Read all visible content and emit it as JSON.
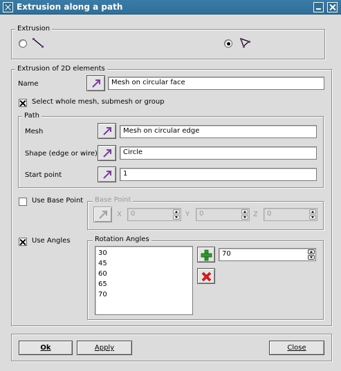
{
  "window": {
    "title": "Extrusion along a path"
  },
  "extrusion": {
    "legend": "Extrusion",
    "selected": "2d"
  },
  "elements2d": {
    "legend": "Extrusion of 2D elements",
    "name_label": "Name",
    "name_value": "Mesh on circular face",
    "select_whole_label": "Select whole mesh, submesh or group",
    "select_whole_checked": true
  },
  "path": {
    "legend": "Path",
    "mesh_label": "Mesh",
    "mesh_value": "Mesh on circular edge",
    "shape_label": "Shape (edge or wire)",
    "shape_value": "Circle",
    "start_label": "Start point",
    "start_value": "1"
  },
  "base_point": {
    "use_label": "Use Base Point",
    "checked": false,
    "legend": "Base Point",
    "x_label": "X",
    "x_value": "0",
    "y_label": "Y",
    "y_value": "0",
    "z_label": "Z",
    "z_value": "0"
  },
  "angles": {
    "use_label": "Use Angles",
    "checked": true,
    "legend": "Rotation Angles",
    "list": [
      "30",
      "45",
      "60",
      "65",
      "70"
    ],
    "input_value": "70"
  },
  "buttons": {
    "ok": "Ok",
    "apply": "Apply",
    "close": "Close"
  },
  "colors": {
    "titlebar": "#2f6f98",
    "arrow_icon": "#7a3aa0",
    "add_icon": "#2e9a2e",
    "remove_icon": "#cc1f1f"
  }
}
